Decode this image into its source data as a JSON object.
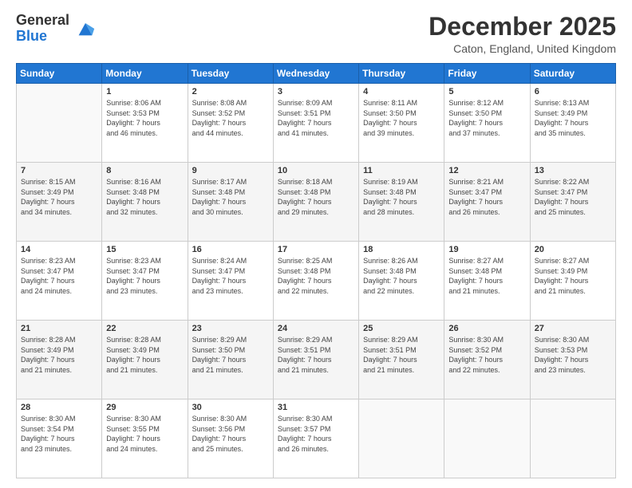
{
  "logo": {
    "line1": "General",
    "line2": "Blue"
  },
  "header": {
    "month": "December 2025",
    "location": "Caton, England, United Kingdom"
  },
  "weekdays": [
    "Sunday",
    "Monday",
    "Tuesday",
    "Wednesday",
    "Thursday",
    "Friday",
    "Saturday"
  ],
  "weeks": [
    [
      {
        "day": "",
        "info": ""
      },
      {
        "day": "1",
        "info": "Sunrise: 8:06 AM\nSunset: 3:53 PM\nDaylight: 7 hours\nand 46 minutes."
      },
      {
        "day": "2",
        "info": "Sunrise: 8:08 AM\nSunset: 3:52 PM\nDaylight: 7 hours\nand 44 minutes."
      },
      {
        "day": "3",
        "info": "Sunrise: 8:09 AM\nSunset: 3:51 PM\nDaylight: 7 hours\nand 41 minutes."
      },
      {
        "day": "4",
        "info": "Sunrise: 8:11 AM\nSunset: 3:50 PM\nDaylight: 7 hours\nand 39 minutes."
      },
      {
        "day": "5",
        "info": "Sunrise: 8:12 AM\nSunset: 3:50 PM\nDaylight: 7 hours\nand 37 minutes."
      },
      {
        "day": "6",
        "info": "Sunrise: 8:13 AM\nSunset: 3:49 PM\nDaylight: 7 hours\nand 35 minutes."
      }
    ],
    [
      {
        "day": "7",
        "info": "Sunrise: 8:15 AM\nSunset: 3:49 PM\nDaylight: 7 hours\nand 34 minutes."
      },
      {
        "day": "8",
        "info": "Sunrise: 8:16 AM\nSunset: 3:48 PM\nDaylight: 7 hours\nand 32 minutes."
      },
      {
        "day": "9",
        "info": "Sunrise: 8:17 AM\nSunset: 3:48 PM\nDaylight: 7 hours\nand 30 minutes."
      },
      {
        "day": "10",
        "info": "Sunrise: 8:18 AM\nSunset: 3:48 PM\nDaylight: 7 hours\nand 29 minutes."
      },
      {
        "day": "11",
        "info": "Sunrise: 8:19 AM\nSunset: 3:48 PM\nDaylight: 7 hours\nand 28 minutes."
      },
      {
        "day": "12",
        "info": "Sunrise: 8:21 AM\nSunset: 3:47 PM\nDaylight: 7 hours\nand 26 minutes."
      },
      {
        "day": "13",
        "info": "Sunrise: 8:22 AM\nSunset: 3:47 PM\nDaylight: 7 hours\nand 25 minutes."
      }
    ],
    [
      {
        "day": "14",
        "info": "Sunrise: 8:23 AM\nSunset: 3:47 PM\nDaylight: 7 hours\nand 24 minutes."
      },
      {
        "day": "15",
        "info": "Sunrise: 8:23 AM\nSunset: 3:47 PM\nDaylight: 7 hours\nand 23 minutes."
      },
      {
        "day": "16",
        "info": "Sunrise: 8:24 AM\nSunset: 3:47 PM\nDaylight: 7 hours\nand 23 minutes."
      },
      {
        "day": "17",
        "info": "Sunrise: 8:25 AM\nSunset: 3:48 PM\nDaylight: 7 hours\nand 22 minutes."
      },
      {
        "day": "18",
        "info": "Sunrise: 8:26 AM\nSunset: 3:48 PM\nDaylight: 7 hours\nand 22 minutes."
      },
      {
        "day": "19",
        "info": "Sunrise: 8:27 AM\nSunset: 3:48 PM\nDaylight: 7 hours\nand 21 minutes."
      },
      {
        "day": "20",
        "info": "Sunrise: 8:27 AM\nSunset: 3:49 PM\nDaylight: 7 hours\nand 21 minutes."
      }
    ],
    [
      {
        "day": "21",
        "info": "Sunrise: 8:28 AM\nSunset: 3:49 PM\nDaylight: 7 hours\nand 21 minutes."
      },
      {
        "day": "22",
        "info": "Sunrise: 8:28 AM\nSunset: 3:49 PM\nDaylight: 7 hours\nand 21 minutes."
      },
      {
        "day": "23",
        "info": "Sunrise: 8:29 AM\nSunset: 3:50 PM\nDaylight: 7 hours\nand 21 minutes."
      },
      {
        "day": "24",
        "info": "Sunrise: 8:29 AM\nSunset: 3:51 PM\nDaylight: 7 hours\nand 21 minutes."
      },
      {
        "day": "25",
        "info": "Sunrise: 8:29 AM\nSunset: 3:51 PM\nDaylight: 7 hours\nand 21 minutes."
      },
      {
        "day": "26",
        "info": "Sunrise: 8:30 AM\nSunset: 3:52 PM\nDaylight: 7 hours\nand 22 minutes."
      },
      {
        "day": "27",
        "info": "Sunrise: 8:30 AM\nSunset: 3:53 PM\nDaylight: 7 hours\nand 23 minutes."
      }
    ],
    [
      {
        "day": "28",
        "info": "Sunrise: 8:30 AM\nSunset: 3:54 PM\nDaylight: 7 hours\nand 23 minutes."
      },
      {
        "day": "29",
        "info": "Sunrise: 8:30 AM\nSunset: 3:55 PM\nDaylight: 7 hours\nand 24 minutes."
      },
      {
        "day": "30",
        "info": "Sunrise: 8:30 AM\nSunset: 3:56 PM\nDaylight: 7 hours\nand 25 minutes."
      },
      {
        "day": "31",
        "info": "Sunrise: 8:30 AM\nSunset: 3:57 PM\nDaylight: 7 hours\nand 26 minutes."
      },
      {
        "day": "",
        "info": ""
      },
      {
        "day": "",
        "info": ""
      },
      {
        "day": "",
        "info": ""
      }
    ]
  ]
}
